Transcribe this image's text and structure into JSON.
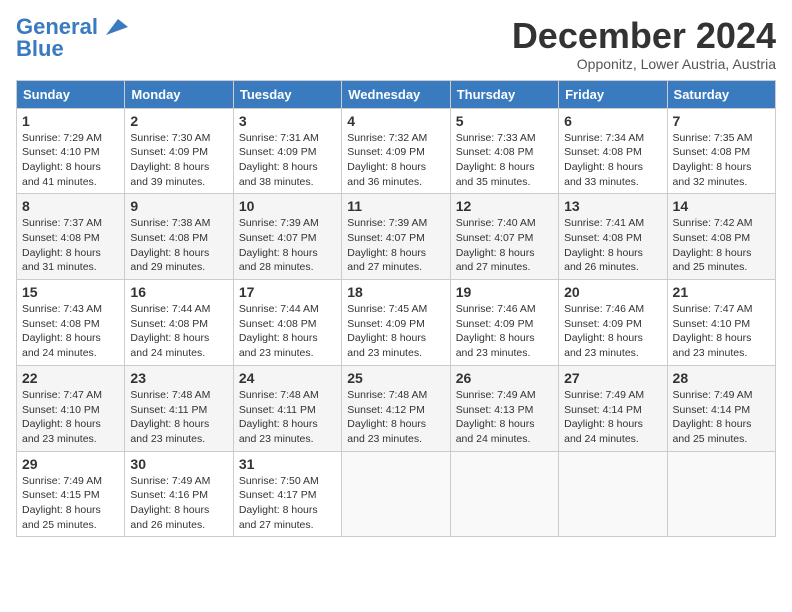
{
  "header": {
    "logo_general": "General",
    "logo_blue": "Blue",
    "title": "December 2024",
    "location": "Opponitz, Lower Austria, Austria"
  },
  "weekdays": [
    "Sunday",
    "Monday",
    "Tuesday",
    "Wednesday",
    "Thursday",
    "Friday",
    "Saturday"
  ],
  "weeks": [
    [
      {
        "day": 1,
        "sunrise": "7:29 AM",
        "sunset": "4:10 PM",
        "daylight": "8 hours and 41 minutes."
      },
      {
        "day": 2,
        "sunrise": "7:30 AM",
        "sunset": "4:09 PM",
        "daylight": "8 hours and 39 minutes."
      },
      {
        "day": 3,
        "sunrise": "7:31 AM",
        "sunset": "4:09 PM",
        "daylight": "8 hours and 38 minutes."
      },
      {
        "day": 4,
        "sunrise": "7:32 AM",
        "sunset": "4:09 PM",
        "daylight": "8 hours and 36 minutes."
      },
      {
        "day": 5,
        "sunrise": "7:33 AM",
        "sunset": "4:08 PM",
        "daylight": "8 hours and 35 minutes."
      },
      {
        "day": 6,
        "sunrise": "7:34 AM",
        "sunset": "4:08 PM",
        "daylight": "8 hours and 33 minutes."
      },
      {
        "day": 7,
        "sunrise": "7:35 AM",
        "sunset": "4:08 PM",
        "daylight": "8 hours and 32 minutes."
      }
    ],
    [
      {
        "day": 8,
        "sunrise": "7:37 AM",
        "sunset": "4:08 PM",
        "daylight": "8 hours and 31 minutes."
      },
      {
        "day": 9,
        "sunrise": "7:38 AM",
        "sunset": "4:08 PM",
        "daylight": "8 hours and 29 minutes."
      },
      {
        "day": 10,
        "sunrise": "7:39 AM",
        "sunset": "4:07 PM",
        "daylight": "8 hours and 28 minutes."
      },
      {
        "day": 11,
        "sunrise": "7:39 AM",
        "sunset": "4:07 PM",
        "daylight": "8 hours and 27 minutes."
      },
      {
        "day": 12,
        "sunrise": "7:40 AM",
        "sunset": "4:07 PM",
        "daylight": "8 hours and 27 minutes."
      },
      {
        "day": 13,
        "sunrise": "7:41 AM",
        "sunset": "4:08 PM",
        "daylight": "8 hours and 26 minutes."
      },
      {
        "day": 14,
        "sunrise": "7:42 AM",
        "sunset": "4:08 PM",
        "daylight": "8 hours and 25 minutes."
      }
    ],
    [
      {
        "day": 15,
        "sunrise": "7:43 AM",
        "sunset": "4:08 PM",
        "daylight": "8 hours and 24 minutes."
      },
      {
        "day": 16,
        "sunrise": "7:44 AM",
        "sunset": "4:08 PM",
        "daylight": "8 hours and 24 minutes."
      },
      {
        "day": 17,
        "sunrise": "7:44 AM",
        "sunset": "4:08 PM",
        "daylight": "8 hours and 23 minutes."
      },
      {
        "day": 18,
        "sunrise": "7:45 AM",
        "sunset": "4:09 PM",
        "daylight": "8 hours and 23 minutes."
      },
      {
        "day": 19,
        "sunrise": "7:46 AM",
        "sunset": "4:09 PM",
        "daylight": "8 hours and 23 minutes."
      },
      {
        "day": 20,
        "sunrise": "7:46 AM",
        "sunset": "4:09 PM",
        "daylight": "8 hours and 23 minutes."
      },
      {
        "day": 21,
        "sunrise": "7:47 AM",
        "sunset": "4:10 PM",
        "daylight": "8 hours and 23 minutes."
      }
    ],
    [
      {
        "day": 22,
        "sunrise": "7:47 AM",
        "sunset": "4:10 PM",
        "daylight": "8 hours and 23 minutes."
      },
      {
        "day": 23,
        "sunrise": "7:48 AM",
        "sunset": "4:11 PM",
        "daylight": "8 hours and 23 minutes."
      },
      {
        "day": 24,
        "sunrise": "7:48 AM",
        "sunset": "4:11 PM",
        "daylight": "8 hours and 23 minutes."
      },
      {
        "day": 25,
        "sunrise": "7:48 AM",
        "sunset": "4:12 PM",
        "daylight": "8 hours and 23 minutes."
      },
      {
        "day": 26,
        "sunrise": "7:49 AM",
        "sunset": "4:13 PM",
        "daylight": "8 hours and 24 minutes."
      },
      {
        "day": 27,
        "sunrise": "7:49 AM",
        "sunset": "4:14 PM",
        "daylight": "8 hours and 24 minutes."
      },
      {
        "day": 28,
        "sunrise": "7:49 AM",
        "sunset": "4:14 PM",
        "daylight": "8 hours and 25 minutes."
      }
    ],
    [
      {
        "day": 29,
        "sunrise": "7:49 AM",
        "sunset": "4:15 PM",
        "daylight": "8 hours and 25 minutes."
      },
      {
        "day": 30,
        "sunrise": "7:49 AM",
        "sunset": "4:16 PM",
        "daylight": "8 hours and 26 minutes."
      },
      {
        "day": 31,
        "sunrise": "7:50 AM",
        "sunset": "4:17 PM",
        "daylight": "8 hours and 27 minutes."
      },
      null,
      null,
      null,
      null
    ]
  ]
}
